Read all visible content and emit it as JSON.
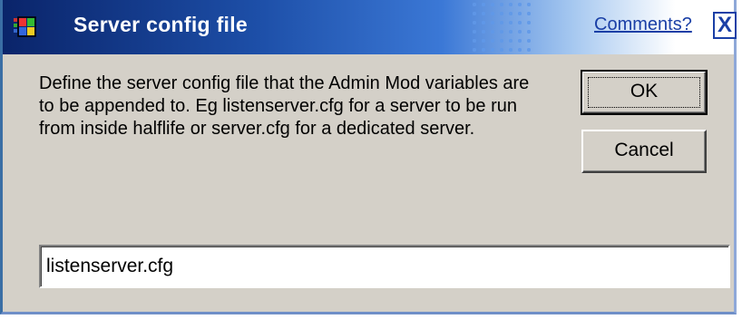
{
  "window": {
    "title": "Server config file",
    "comments_link": "Comments?",
    "close_symbol": "X",
    "title_gradient_start": "#0a246a",
    "link_color": "#1a3fa6"
  },
  "dialog": {
    "description": "Define the server config file that the Admin Mod variables are to be appended to. Eg listenserver.cfg for a server to be run from inside halflife or server.cfg for a dedicated server.",
    "ok_label": "OK",
    "cancel_label": "Cancel",
    "input_value": "listenserver.cfg"
  },
  "icons": {
    "app_icon": "windows-logo-icon",
    "close_icon": "close-icon"
  }
}
